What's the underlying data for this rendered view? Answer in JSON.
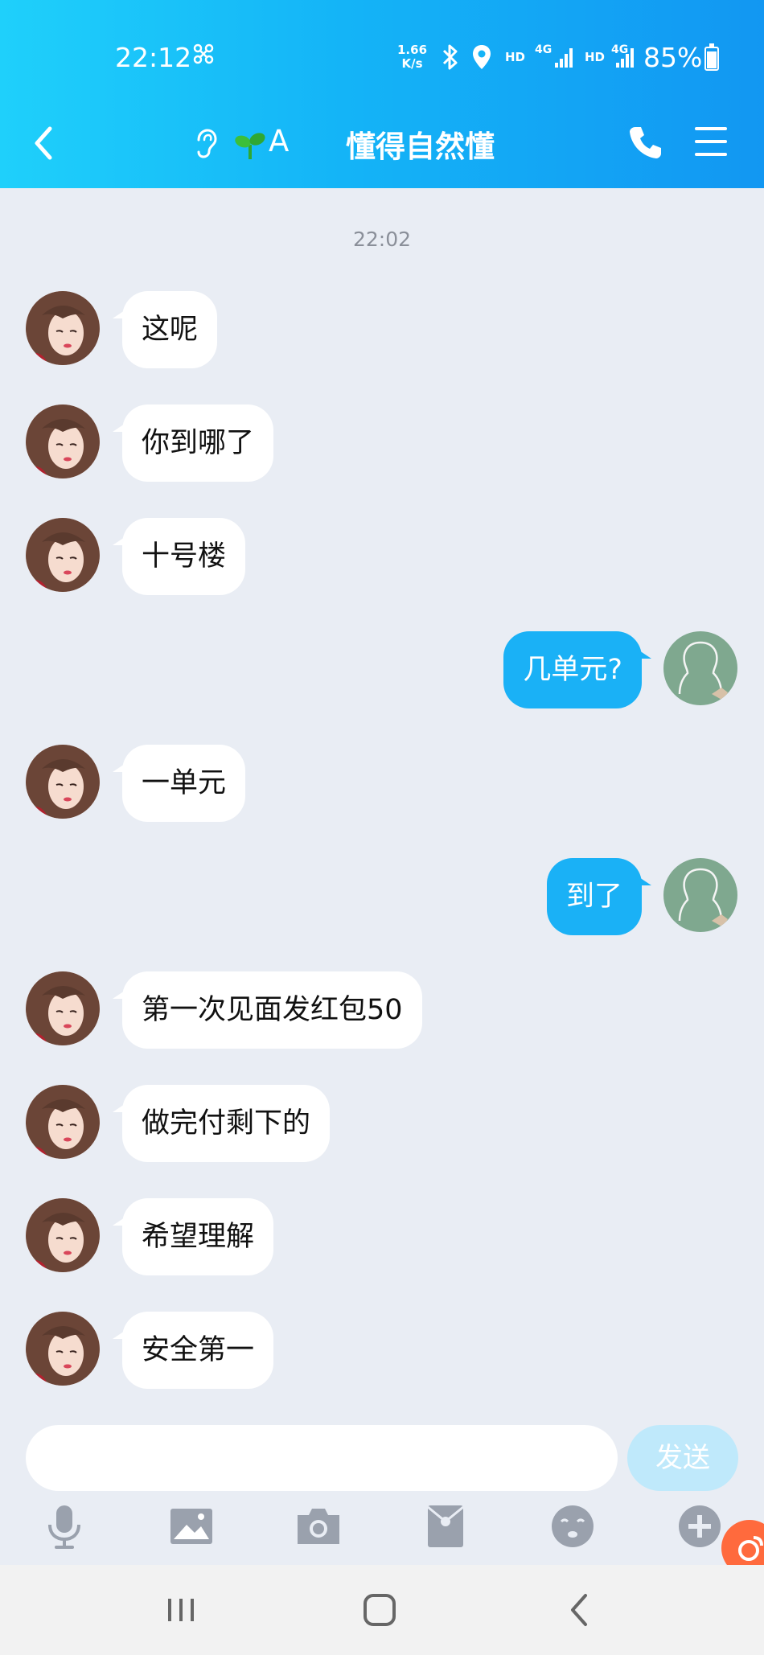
{
  "status_bar": {
    "time": "22:12",
    "net_speed_value": "1.66",
    "net_speed_unit": "K/s",
    "hd1": "HD",
    "net1": "4G",
    "hd2": "HD",
    "net2": "4G",
    "battery": "85%"
  },
  "header": {
    "title_prefix": "A",
    "title": "懂得自然懂"
  },
  "chat": {
    "timestamp": "22:02",
    "messages": [
      {
        "side": "left",
        "text": "这呢"
      },
      {
        "side": "left",
        "text": "你到哪了"
      },
      {
        "side": "left",
        "text": "十号楼"
      },
      {
        "side": "right",
        "text": "几单元?"
      },
      {
        "side": "left",
        "text": "一单元"
      },
      {
        "side": "right",
        "text": "到了"
      },
      {
        "side": "left",
        "text": "第一次见面发红包50"
      },
      {
        "side": "left",
        "text": "做完付剩下的"
      },
      {
        "side": "left",
        "text": "希望理解"
      },
      {
        "side": "left",
        "text": "安全第一"
      }
    ]
  },
  "composer": {
    "input_value": "",
    "send_label": "发送"
  },
  "colors": {
    "header_start": "#1fd0fb",
    "header_end": "#1297f2",
    "outgoing_bubble": "#1ab1f6",
    "send_disabled": "#bfe9fb"
  }
}
